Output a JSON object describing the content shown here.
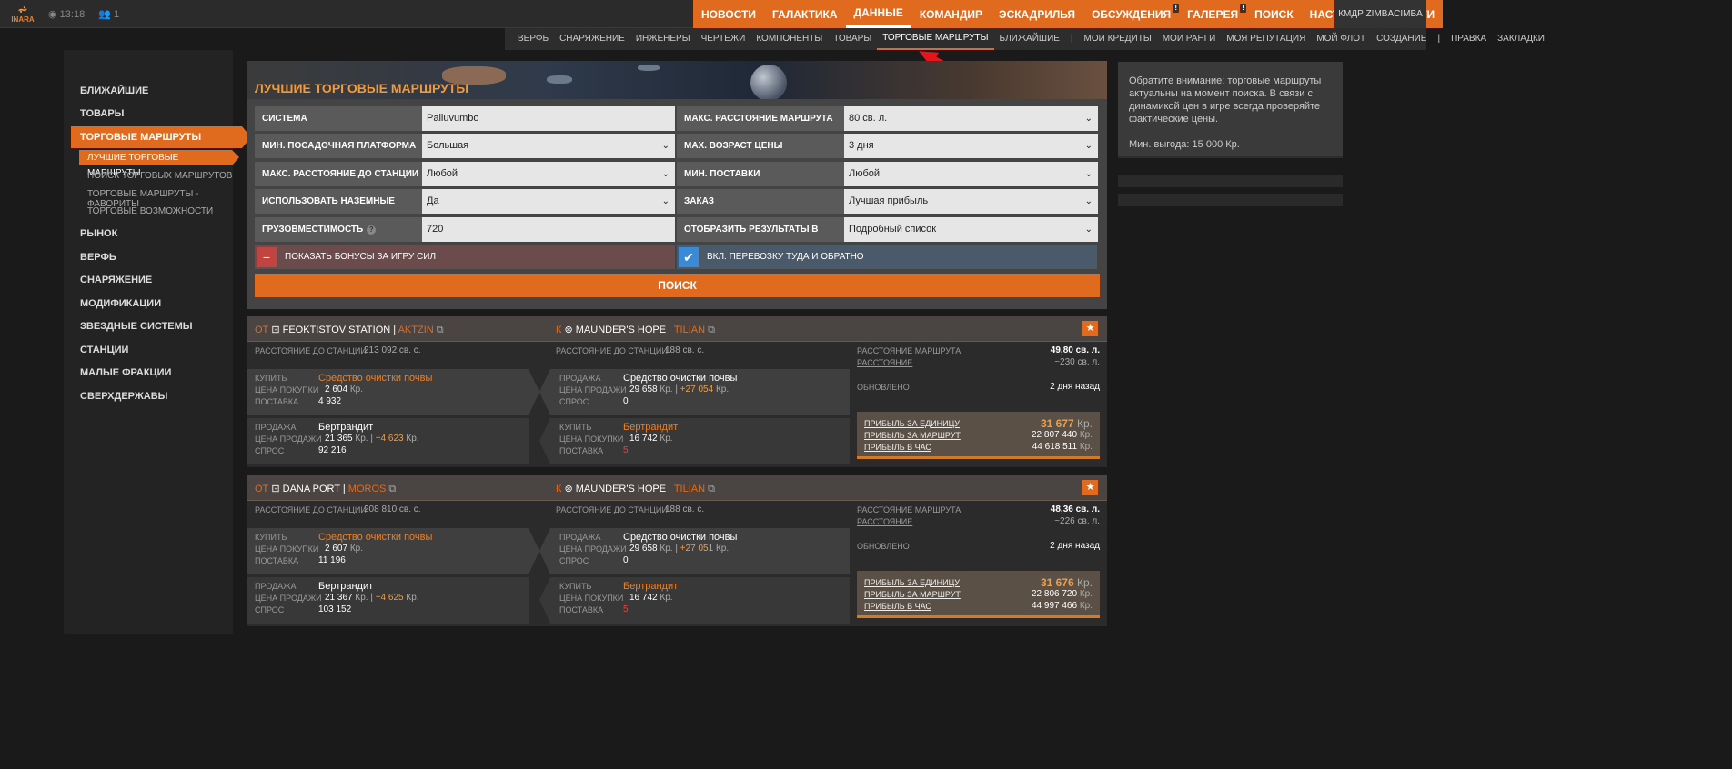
{
  "topbar": {
    "logo": "INARA",
    "time": "13:18",
    "users": "1",
    "nav": [
      "НОВОСТИ",
      "ГАЛАКТИКА",
      "ДАННЫЕ",
      "КОМАНДИР",
      "ЭСКАДРИЛЬЯ",
      "ОБСУЖДЕНИЯ",
      "ГАЛЕРЕЯ",
      "ПОИСК",
      "НАСТРОЙКИ",
      "ВЫЙТИ"
    ],
    "bang": "!",
    "cmdr": "КМДР ZIMBACIMBA"
  },
  "subnav": [
    "ВЕРФЬ",
    "СНАРЯЖЕНИЕ",
    "ИНЖЕНЕРЫ",
    "ЧЕРТЕЖИ",
    "КОМПОНЕНТЫ",
    "ТОВАРЫ",
    "ТОРГОВЫЕ МАРШРУТЫ",
    "БЛИЖАЙШИЕ",
    "|",
    "МОИ КРЕДИТЫ",
    "МОИ РАНГИ",
    "МОЯ РЕПУТАЦИЯ",
    "МОЙ ФЛОТ",
    "СОЗДАНИЕ",
    "|",
    "ПРАВКА",
    "ЗАКЛАДКИ"
  ],
  "sidebar": {
    "items": [
      "БЛИЖАЙШИЕ",
      "ТОВАРЫ",
      "ТОРГОВЫЕ МАРШРУТЫ",
      "РЫНОК",
      "ВЕРФЬ",
      "СНАРЯЖЕНИЕ",
      "МОДИФИКАЦИИ",
      "ЗВЕЗДНЫЕ СИСТЕМЫ",
      "СТАНЦИИ",
      "МАЛЫЕ ФРАКЦИИ",
      "СВЕРХДЕРЖАВЫ"
    ],
    "subitems": [
      "ЛУЧШИЕ ТОРГОВЫЕ МАРШРУТЫ",
      "ПОИСК ТОРГОВЫХ МАРШРУТОВ",
      "ТОРГОВЫЕ МАРШРУТЫ - ФАВОРИТЫ",
      "ТОРГОВЫЕ ВОЗМОЖНОСТИ"
    ]
  },
  "form": {
    "title": "ЛУЧШИЕ ТОРГОВЫЕ МАРШРУТЫ",
    "left": [
      {
        "label": "СИСТЕМА",
        "value": "Palluvumbo"
      },
      {
        "label": "МИН. ПОСАДОЧНАЯ ПЛАТФОРМА",
        "value": "Большая"
      },
      {
        "label": "МАКС. РАССТОЯНИЕ ДО СТАНЦИИ",
        "value": "Любой"
      },
      {
        "label": "ИСПОЛЬЗОВАТЬ НАЗЕМНЫЕ СТАНЦИИ",
        "value": "Да"
      },
      {
        "label": "ГРУЗОВМЕСТИМОСТЬ",
        "value": "720",
        "help": "?"
      }
    ],
    "right": [
      {
        "label": "МАКС. РАССТОЯНИЕ МАРШРУТА",
        "value": "80 св. л."
      },
      {
        "label": "MAX. ВОЗРАСТ ЦЕНЫ",
        "value": "3 дня"
      },
      {
        "label": "МИН. ПОСТАВКИ",
        "value": "Любой"
      },
      {
        "label": "ЗАКАЗ",
        "value": "Лучшая прибыль"
      },
      {
        "label": "ОТОБРАЗИТЬ РЕЗУЛЬТАТЫ В ВИДЕ",
        "value": "Подробный список"
      }
    ],
    "toggle_left": "ПОКАЗАТЬ БОНУСЫ ЗА ИГРУ СИЛ",
    "toggle_right": "ВКЛ. ПЕРЕВОЗКУ ТУДА И ОБРАТНО",
    "search": "ПОИСК"
  },
  "note": {
    "text1": "Обратите внимание: торговые маршруты актуальны на момент поиска. В связи с динамикой цен в игре всегда проверяйте фактические цены.",
    "text2": "Мин. выгода: 15 000 Кр."
  },
  "labels": {
    "from": "ОТ",
    "to": "К",
    "dist_station": "РАССТОЯНИЕ ДО СТАНЦИИ",
    "buy": "КУПИТЬ",
    "sell": "ПРОДАЖА",
    "buy_price": "ЦЕНА ПОКУПКИ",
    "sell_price": "ЦЕНА ПРОДАЖИ",
    "supply": "ПОСТАВКА",
    "demand": "СПРОС",
    "route_dist": "РАССТОЯНИЕ МАРШРУТА",
    "dist": "РАССТОЯНИЕ",
    "updated": "ОБНОВЛЕНО",
    "ppu": "ПРИБЫЛЬ ЗА ЕДИНИЦУ",
    "ppr": "ПРИБЫЛЬ ЗА МАРШРУТ",
    "pph": "ПРИБЫЛЬ В ЧАС",
    "cr": "Кр.",
    "sep": "|",
    "star": "★"
  },
  "routes": [
    {
      "from_station": "FEOKTISTOV STATION",
      "from_system": "AKTZIN",
      "from_dist": "213 092 св. с.",
      "to_station": "MAUNDER'S HOPE",
      "to_system": "TILIAN",
      "to_dist": "188 св. с.",
      "buy1": "Средство очистки почвы",
      "buy1_price": "2 604",
      "buy1_supply": "4 932",
      "sell1": "Средство очистки почвы",
      "sell1_price": "29 658",
      "sell1_diff": "+27 054",
      "sell1_demand": "0",
      "sell2": "Бертрандит",
      "sell2_price": "21 365",
      "sell2_diff": "+4 623",
      "sell2_demand": "92 216",
      "buy2": "Бертрандит",
      "buy2_price": "16 742",
      "buy2_supply": "5",
      "route_dist": "49,80 св. л.",
      "dist": "~230 св. л.",
      "updated": "2 дня назад",
      "ppu": "31 677",
      "ppr": "22 807 440",
      "pph": "44 618 511"
    },
    {
      "from_station": "DANA PORT",
      "from_system": "MOROS",
      "from_dist": "208 810 св. с.",
      "to_station": "MAUNDER'S HOPE",
      "to_system": "TILIAN",
      "to_dist": "188 св. с.",
      "buy1": "Средство очистки почвы",
      "buy1_price": "2 607",
      "buy1_supply": "11 196",
      "sell1": "Средство очистки почвы",
      "sell1_price": "29 658",
      "sell1_diff": "+27 051",
      "sell1_demand": "0",
      "sell2": "Бертрандит",
      "sell2_price": "21 367",
      "sell2_diff": "+4 625",
      "sell2_demand": "103 152",
      "buy2": "Бертрандит",
      "buy2_price": "16 742",
      "buy2_supply": "5",
      "route_dist": "48,36 св. л.",
      "dist": "~226 св. л.",
      "updated": "2 дня назад",
      "ppu": "31 676",
      "ppr": "22 806 720",
      "pph": "44 997 466"
    }
  ]
}
